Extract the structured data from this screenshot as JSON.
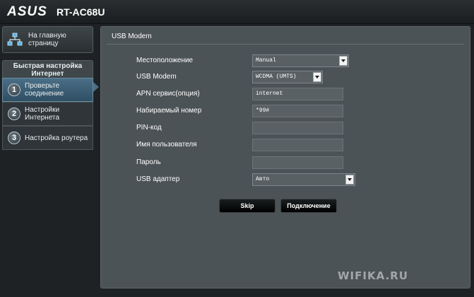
{
  "header": {
    "brand": "ASUS",
    "model": "RT-AC68U"
  },
  "sidebar": {
    "home_label": "На главную страницу",
    "qis_title": "Быстрая настройка Интернет",
    "steps": [
      {
        "num": "1",
        "label": "Проверьте соединение",
        "active": true
      },
      {
        "num": "2",
        "label": "Настройки Интернета",
        "active": false
      },
      {
        "num": "3",
        "label": "Настройка роутера",
        "active": false
      }
    ]
  },
  "panel": {
    "title": "USB Modem",
    "fields": {
      "location": {
        "label": "Местоположение",
        "value": "Manual"
      },
      "usb_modem": {
        "label": "USB Modem",
        "value": "WCDMA (UMTS)"
      },
      "apn": {
        "label": "APN сервис(опция)",
        "value": "internet"
      },
      "dial": {
        "label": "Набираемый номер",
        "value": "*99#"
      },
      "pin": {
        "label": "PIN-код",
        "value": ""
      },
      "username": {
        "label": "Имя пользователя",
        "value": ""
      },
      "password": {
        "label": "Пароль",
        "value": ""
      },
      "adapter": {
        "label": "USB адаптер",
        "value": "Авто"
      }
    },
    "buttons": {
      "skip": "Skip",
      "connect": "Подключение"
    }
  },
  "watermark": "WIFIKA.RU",
  "colors": {
    "background": "#1e2224",
    "panel": "#4c5356",
    "active_step": "#4a6f86"
  }
}
